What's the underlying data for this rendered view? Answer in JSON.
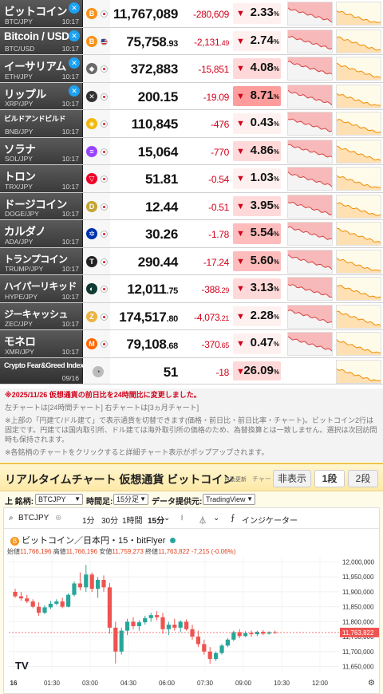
{
  "rows": [
    {
      "name": "ビットコイン",
      "pair": "BTC/JPY",
      "time": "10:17",
      "x": true,
      "coin": "B",
      "coin_color": "#f7931a",
      "flag": "jp",
      "price": "11,767,089",
      "price_dec": "",
      "chg": "-280,609",
      "chg_dec": "",
      "pct": "2.33",
      "level": "l1",
      "style": ""
    },
    {
      "name": "Bitcoin / USD",
      "pair": "BTC/USD",
      "time": "10:17",
      "x": true,
      "coin": "B",
      "coin_color": "#f7931a",
      "flag": "us",
      "price": "75,758",
      "price_dec": ".93",
      "chg": "-2,131",
      "chg_dec": ".49",
      "pct": "2.74",
      "level": "l1",
      "style": ""
    },
    {
      "name": "イーサリアム",
      "pair": "ETH/JPY",
      "time": "10:17",
      "x": true,
      "coin": "◆",
      "coin_color": "#6a6a6a",
      "flag": "jp",
      "price": "372,883",
      "price_dec": "",
      "chg": "-15,851",
      "chg_dec": "",
      "pct": "4.08",
      "level": "l2",
      "style": ""
    },
    {
      "name": "リップル",
      "pair": "XRP/JPY",
      "time": "10:17",
      "x": true,
      "coin": "✕",
      "coin_color": "#333",
      "flag": "jp",
      "price": "200.15",
      "price_dec": "",
      "chg": "-19.09",
      "chg_dec": "",
      "pct": "8.71",
      "level": "l4",
      "style": ""
    },
    {
      "name": "ビルドアンドビルド",
      "pair": "BNB/JPY",
      "time": "10:17",
      "x": false,
      "coin": "◈",
      "coin_color": "#f0b90b",
      "flag": "jp",
      "price": "110,845",
      "price_dec": "",
      "chg": "-476",
      "chg_dec": "",
      "pct": "0.43",
      "level": "l1",
      "style": "tiny"
    },
    {
      "name": "ソラナ",
      "pair": "SOL/JPY",
      "time": "10:17",
      "x": false,
      "coin": "≡",
      "coin_color": "#9945ff",
      "flag": "jp",
      "price": "15,064",
      "price_dec": "",
      "chg": "-770",
      "chg_dec": "",
      "pct": "4.86",
      "level": "l2",
      "style": ""
    },
    {
      "name": "トロン",
      "pair": "TRX/JPY",
      "time": "10:17",
      "x": false,
      "coin": "▽",
      "coin_color": "#ef0027",
      "flag": "jp",
      "price": "51.81",
      "price_dec": "",
      "chg": "-0.54",
      "chg_dec": "",
      "pct": "1.03",
      "level": "l1",
      "style": ""
    },
    {
      "name": "ドージコイン",
      "pair": "DOGE/JPY",
      "time": "10:17",
      "x": false,
      "coin": "D",
      "coin_color": "#c2a633",
      "flag": "jp",
      "price": "12.44",
      "price_dec": "",
      "chg": "-0.51",
      "chg_dec": "",
      "pct": "3.95",
      "level": "l2",
      "style": ""
    },
    {
      "name": "カルダノ",
      "pair": "ADA/JPY",
      "time": "10:17",
      "x": false,
      "coin": "✲",
      "coin_color": "#0033ad",
      "flag": "jp",
      "price": "30.26",
      "price_dec": "",
      "chg": "-1.78",
      "chg_dec": "",
      "pct": "5.54",
      "level": "l3",
      "style": ""
    },
    {
      "name": "トランプコイン",
      "pair": "TRUMP/JPY",
      "time": "10:17",
      "x": false,
      "coin": "T",
      "coin_color": "#222",
      "flag": "jp",
      "price": "290.44",
      "price_dec": "",
      "chg": "-17.24",
      "chg_dec": "",
      "pct": "5.60",
      "level": "l3",
      "style": "small"
    },
    {
      "name": "ハイパーリキッド",
      "pair": "HYPE/JPY",
      "time": "10:17",
      "x": false,
      "coin": "◐",
      "coin_color": "#0f3b33",
      "flag": "jp",
      "price": "12,011",
      "price_dec": ".75",
      "chg": "-388",
      "chg_dec": ".29",
      "pct": "3.13",
      "level": "l2",
      "style": "small"
    },
    {
      "name": "ジーキャッシュ",
      "pair": "ZEC/JPY",
      "time": "10:17",
      "x": false,
      "coin": "Z",
      "coin_color": "#ecb244",
      "flag": "jp",
      "price": "174,517",
      "price_dec": ".80",
      "chg": "-4,073",
      "chg_dec": ".21",
      "pct": "2.28",
      "level": "l1",
      "style": "small"
    },
    {
      "name": "モネロ",
      "pair": "XMR/JPY",
      "time": "10:17",
      "x": false,
      "coin": "M",
      "coin_color": "#ff6600",
      "flag": "jp",
      "price": "79,108",
      "price_dec": ".68",
      "chg": "-370",
      "chg_dec": ".65",
      "pct": "0.47",
      "level": "l1",
      "style": ""
    }
  ],
  "fear_greed": {
    "name": "Crypto Fear&Greed Index",
    "date": "09/16",
    "value": "51",
    "chg": "-18",
    "pct": "26.09"
  },
  "notes": {
    "red": "※2025/11/26 仮想通貨の前日比を24時間比に変更しました。",
    "charts": "左チャートは[24時間チャート] 右チャートは[3ヵ月チャート]",
    "desc": "※上部の「円建て/ドル建て」で表示通貨を切替できます(価格・前日比・前日比率・チャート)。ビットコイン2行は固定です。円建ては国内取引所、ドル建ては海外取引所の価格のため、為替換算とは一致しません。選択は次回訪問時も保持されます。",
    "popup": "※各銘柄のチャートをクリックすると詳細チャート表示がポップアップされます。"
  },
  "rtc": {
    "title": "リアルタイムチャート 仮想通貨 ビットコイン",
    "auto": "自動更新",
    "chart_label": "チャート:",
    "btn_hide": "非表示",
    "btn_1": "1段",
    "btn_2": "2段",
    "lbl_symbol": "上 銘柄:",
    "symbol": "BTCJPY",
    "lbl_time": "時間足:",
    "timeframe": "15分足",
    "lbl_provider": "データ提供元:",
    "provider": "TradingView"
  },
  "tv": {
    "symbol": "BTCJPY",
    "tf_1": "1分",
    "tf_30": "30分",
    "tf_1h": "1時間",
    "tf_15": "15分",
    "indicator": "インジケーター",
    "title": "ビットコイン／日本円・15・bitFlyer",
    "ohlc_o_lbl": "始値",
    "ohlc_o": "11,766,196",
    "ohlc_h_lbl": "高値",
    "ohlc_h": "11,766,196",
    "ohlc_l_lbl": "安値",
    "ohlc_l": "11,759,273",
    "ohlc_c_lbl": "終値",
    "ohlc_c": "11,763,822",
    "ohlc_chg": "-7,215 (-0.06%)",
    "logo": "TV",
    "last_price": "11,763,822",
    "up_color": "#26a69a",
    "down_color": "#ef5350"
  },
  "chart_data": {
    "type": "candlestick",
    "x": [
      "16",
      "01:30",
      "03:00",
      "04:30",
      "06:00",
      "07:30",
      "09:00",
      "10:30",
      "12:00"
    ],
    "y_ticks": [
      "12,000,000",
      "11,950,000",
      "11,900,000",
      "11,850,000",
      "11,800,000",
      "11,750,000",
      "11,700,000",
      "11,650,000"
    ],
    "ylim": [
      11630000,
      12020000
    ],
    "candles": [
      [
        11900000,
        11910000,
        11880000,
        11885000
      ],
      [
        11885000,
        11900000,
        11870000,
        11878000
      ],
      [
        11878000,
        11890000,
        11862000,
        11868000
      ],
      [
        11868000,
        11875000,
        11845000,
        11850000
      ],
      [
        11850000,
        11865000,
        11820000,
        11830000
      ],
      [
        11830000,
        11855000,
        11825000,
        11848000
      ],
      [
        11848000,
        11870000,
        11842000,
        11860000
      ],
      [
        11860000,
        11875000,
        11855000,
        11868000
      ],
      [
        11868000,
        11880000,
        11845000,
        11850000
      ],
      [
        11850000,
        11895000,
        11848000,
        11890000
      ],
      [
        11890000,
        11935000,
        11885000,
        11928000
      ],
      [
        11928000,
        11965000,
        11905000,
        11915000
      ],
      [
        11915000,
        11990000,
        11900000,
        11958000
      ],
      [
        11958000,
        11965000,
        11900000,
        11910000
      ],
      [
        11910000,
        11950000,
        11880000,
        11940000
      ],
      [
        11940000,
        11955000,
        11900000,
        11915000
      ],
      [
        11915000,
        11930000,
        11760000,
        11780000
      ],
      [
        11780000,
        11800000,
        11660000,
        11700000
      ],
      [
        11700000,
        11780000,
        11690000,
        11770000
      ],
      [
        11770000,
        11810000,
        11755000,
        11800000
      ],
      [
        11800000,
        11815000,
        11775000,
        11785000
      ],
      [
        11785000,
        11805000,
        11770000,
        11798000
      ],
      [
        11798000,
        11820000,
        11790000,
        11812000
      ],
      [
        11812000,
        11830000,
        11800000,
        11822000
      ],
      [
        11822000,
        11835000,
        11805000,
        11815000
      ],
      [
        11815000,
        11830000,
        11760000,
        11775000
      ],
      [
        11775000,
        11800000,
        11755000,
        11790000
      ],
      [
        11790000,
        11810000,
        11770000,
        11780000
      ],
      [
        11780000,
        11805000,
        11765000,
        11800000
      ],
      [
        11800000,
        11808000,
        11770000,
        11775000
      ],
      [
        11775000,
        11790000,
        11740000,
        11750000
      ],
      [
        11750000,
        11770000,
        11715000,
        11725000
      ],
      [
        11725000,
        11740000,
        11690000,
        11700000
      ],
      [
        11700000,
        11715000,
        11660000,
        11675000
      ],
      [
        11675000,
        11700000,
        11668000,
        11695000
      ],
      [
        11695000,
        11725000,
        11690000,
        11720000
      ],
      [
        11720000,
        11745000,
        11715000,
        11740000
      ],
      [
        11740000,
        11770000,
        11735000,
        11765000
      ],
      [
        11765000,
        11775000,
        11745000,
        11752000
      ],
      [
        11752000,
        11768000,
        11748000,
        11762000
      ],
      [
        11762000,
        11770000,
        11750000,
        11758000
      ],
      [
        11758000,
        11770000,
        11752000,
        11766000
      ],
      [
        11766000,
        11772000,
        11755000,
        11760000
      ],
      [
        11760000,
        11768000,
        11757000,
        11765000
      ],
      [
        11765000,
        11770000,
        11759000,
        11764000
      ]
    ]
  }
}
